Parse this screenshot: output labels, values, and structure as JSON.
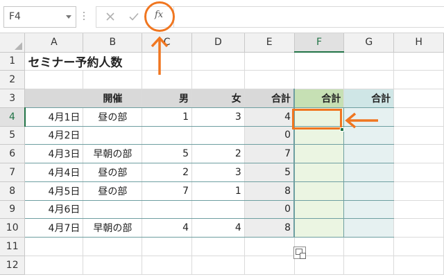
{
  "formula_bar": {
    "name_box": "F4",
    "cancel_icon": "cancel-icon",
    "enter_icon": "enter-icon",
    "fx_label": "fx",
    "formula_value": ""
  },
  "columns": [
    "A",
    "B",
    "C",
    "D",
    "E",
    "F",
    "G",
    "H"
  ],
  "rows": [
    "1",
    "2",
    "3",
    "4",
    "5",
    "6",
    "7",
    "8",
    "9",
    "10",
    "11",
    "12"
  ],
  "active_cell": {
    "column": "F",
    "row": "4"
  },
  "sheet": {
    "title": "セミナー予約人数",
    "headers": {
      "session": "開催",
      "male": "男",
      "female": "女",
      "total_e": "合計",
      "total_f": "合計",
      "total_g": "合計"
    },
    "data": [
      {
        "date": "4月1日",
        "session": "昼の部",
        "male": "1",
        "female": "3",
        "total": "4"
      },
      {
        "date": "4月2日",
        "session": "",
        "male": "",
        "female": "",
        "total": "0"
      },
      {
        "date": "4月3日",
        "session": "早朝の部",
        "male": "5",
        "female": "2",
        "total": "7"
      },
      {
        "date": "4月4日",
        "session": "昼の部",
        "male": "2",
        "female": "3",
        "total": "5"
      },
      {
        "date": "4月5日",
        "session": "昼の部",
        "male": "7",
        "female": "1",
        "total": "8"
      },
      {
        "date": "4月6日",
        "session": "",
        "male": "",
        "female": "",
        "total": "0"
      },
      {
        "date": "4月7日",
        "session": "早朝の部",
        "male": "4",
        "female": "4",
        "total": "8"
      }
    ]
  },
  "colors": {
    "accent": "#f07620",
    "excel_green": "#217346"
  }
}
